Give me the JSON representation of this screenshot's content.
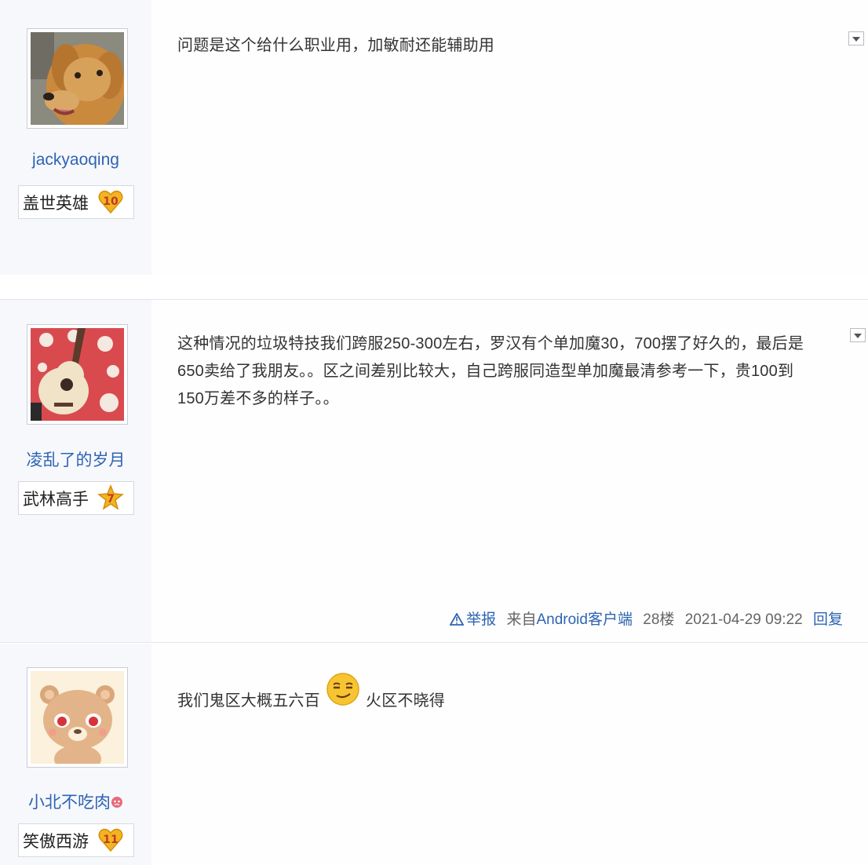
{
  "posts": [
    {
      "username": "jackyaoqing",
      "level_title": "盖世英雄",
      "level": "10",
      "message": "问题是这个给什么职业用，加敏耐还能辅助用"
    },
    {
      "username": "凌乱了的岁月",
      "level_title": "武林高手",
      "level": "7",
      "message_lines": [
        "这种情况的垃圾特技我们跨服250-300左右，罗汉有个单加魔30，700摆了好久的，最后是",
        "650卖给了我朋友。。区之间差别比较大，自己跨服同造型单加魔最清参考一下，贵100到",
        "150万差不多的样子。。"
      ],
      "footer": {
        "report": "举报",
        "from": "来自",
        "client": "Android客户端",
        "floor": "28楼",
        "timestamp": "2021-04-29 09:22",
        "reply": "回复"
      }
    },
    {
      "username": "小北不吃肉",
      "level_title": "笑傲西游",
      "level": "11",
      "message_part1": "我们鬼区大概五六百",
      "message_part2": "火区不晓得"
    }
  ],
  "colors": {
    "link": "#2d64b3",
    "sidebar_bg": "#f7f8fc",
    "badge_gold": "#f2b51f"
  },
  "icons": {
    "dropdown": "chevron-down-icon",
    "report": "warning-triangle-icon",
    "emoji": "smirk-emoji-icon",
    "level_badge": "heart-badge-icon",
    "level_badge_star": "star-badge-icon"
  }
}
